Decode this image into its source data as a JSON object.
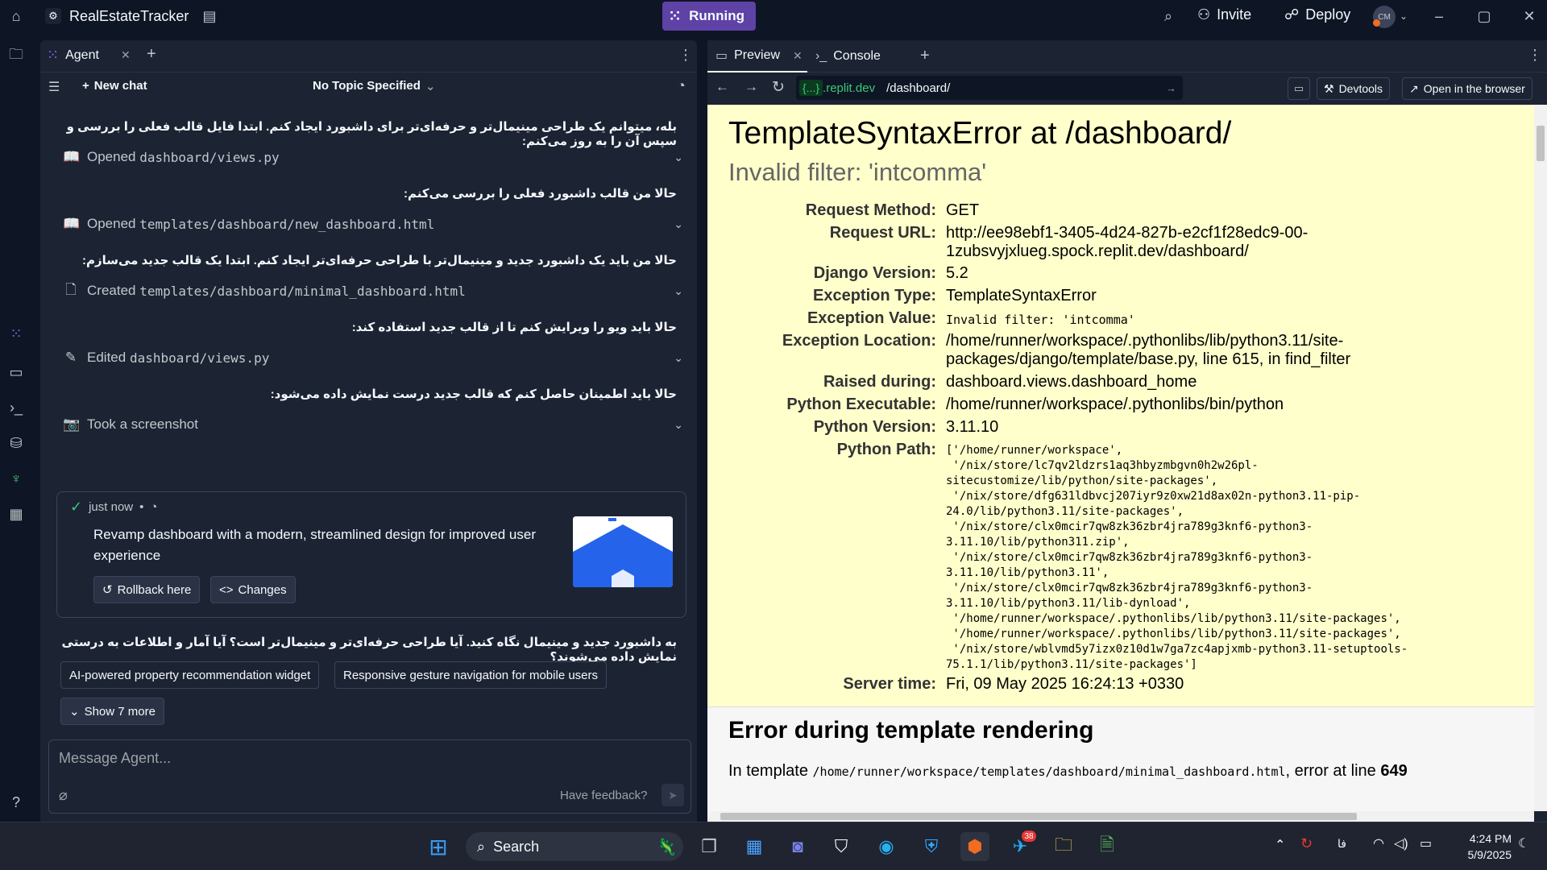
{
  "topbar": {
    "app_title": "RealEstateTracker",
    "running_label": "Running",
    "invite_label": "Invite",
    "deploy_label": "Deploy",
    "avatar_initials": "CM"
  },
  "agent": {
    "tab_label": "Agent",
    "new_chat_label": "New chat",
    "topic_label": "No Topic Specified",
    "messages": [
      "بله، میتوانم یک طراحی مینیمال‌تر و حرفه‌ای‌تر برای داشبورد ایجاد کنم. ابتدا فایل قالب فعلی را بررسی و سپس آن را به روز می‌کنم:",
      "حالا من قالب داشبورد فعلی را بررسی می‌کنم:",
      "حالا من باید یک داشبورد جدید و مینیمال‌تر با طراحی حرفه‌ای‌تر ایجاد کنم. ابتدا یک قالب جدید می‌سازم:",
      "حالا باید ویو را ویرایش کنم تا از قالب جدید استفاده کند:",
      "حالا باید اطمینان حاصل کنم که قالب جدید درست نمایش داده می‌شود:"
    ],
    "actions": [
      {
        "verb": "Opened",
        "target": "dashboard/views.py"
      },
      {
        "verb": "Opened",
        "target": "templates/dashboard/new_dashboard.html"
      },
      {
        "verb": "Created",
        "target": "templates/dashboard/minimal_dashboard.html"
      },
      {
        "verb": "Edited",
        "target": "dashboard/views.py"
      },
      {
        "verb": "Took a screenshot",
        "target": ""
      }
    ],
    "checkpoint": {
      "time": "just now",
      "dot": "•",
      "description": "Revamp dashboard with a modern, streamlined design for improved user experience",
      "rollback_label": "Rollback here",
      "changes_label": "Changes"
    },
    "question": "به داشبورد جدید و مینیمال نگاه کنید. آیا طراحی حرفه‌ای‌تر و مینیمال‌تر است؟ آیا آمار و اطلاعات به درستی نمایش داده می‌شوند؟",
    "suggestions": [
      "AI-powered property recommendation widget",
      "Responsive gesture navigation for mobile users"
    ],
    "show_more_label": "Show 7 more",
    "message_placeholder": "Message Agent...",
    "feedback_label": "Have feedback?"
  },
  "preview": {
    "tab_preview": "Preview",
    "tab_console": "Console",
    "url_domain_badge": "{...}",
    "url_domain": ".replit.dev",
    "url_path": "/dashboard/",
    "devtools_label": "Devtools",
    "open_browser_label": "Open in the browser",
    "error_title": "TemplateSyntaxError at /dashboard/",
    "error_subtitle": "Invalid filter: 'intcomma'",
    "meta": [
      {
        "key": "Request Method:",
        "value": "GET"
      },
      {
        "key": "Request URL:",
        "value": "http://ee98ebf1-3405-4d24-827b-e2cf1f28edc9-00-1zubsvyjxlueg.spock.replit.dev/dashboard/"
      },
      {
        "key": "Django Version:",
        "value": "5.2"
      },
      {
        "key": "Exception Type:",
        "value": "TemplateSyntaxError"
      },
      {
        "key": "Exception Value:",
        "value": "Invalid filter: 'intcomma'"
      },
      {
        "key": "Exception Location:",
        "value": "/home/runner/workspace/.pythonlibs/lib/python3.11/site-packages/django/template/base.py, line 615, in find_filter"
      },
      {
        "key": "Raised during:",
        "value": "dashboard.views.dashboard_home"
      },
      {
        "key": "Python Executable:",
        "value": "/home/runner/workspace/.pythonlibs/bin/python"
      },
      {
        "key": "Python Version:",
        "value": "3.11.10"
      },
      {
        "key": "Python Path:",
        "value": "['/home/runner/workspace',\n '/nix/store/lc7qv2ldzrs1aq3hbyzmbgvn0h2w26pl-\nsitecustomize/lib/python/site-packages',\n '/nix/store/dfg631ldbvcj207iyr9z0xw21d8ax02n-python3.11-pip-\n24.0/lib/python3.11/site-packages',\n '/nix/store/clx0mcir7qw8zk36zbr4jra789g3knf6-python3-\n3.11.10/lib/python311.zip',\n '/nix/store/clx0mcir7qw8zk36zbr4jra789g3knf6-python3-\n3.11.10/lib/python3.11',\n '/nix/store/clx0mcir7qw8zk36zbr4jra789g3knf6-python3-\n3.11.10/lib/python3.11/lib-dynload',\n '/home/runner/workspace/.pythonlibs/lib/python3.11/site-packages',\n '/home/runner/workspace/.pythonlibs/lib/python3.11/site-packages',\n '/nix/store/wblvmd5y7izx0z10d1w7ga7zc4apjxmb-python3.11-setuptools-\n75.1.1/lib/python3.11/site-packages']"
      },
      {
        "key": "Server time:",
        "value": "Fri, 09 May 2025 16:24:13 +0330"
      }
    ],
    "template_heading": "Error during template rendering",
    "template_prefix": "In template",
    "template_path": "/home/runner/workspace/templates/dashboard/minimal_dashboard.html",
    "template_mid": ", error at line",
    "template_line": "649"
  },
  "taskbar": {
    "search_label": "Search",
    "telegram_badge": "38",
    "lang": "فا",
    "time": "4:24 PM",
    "date": "5/9/2025"
  }
}
